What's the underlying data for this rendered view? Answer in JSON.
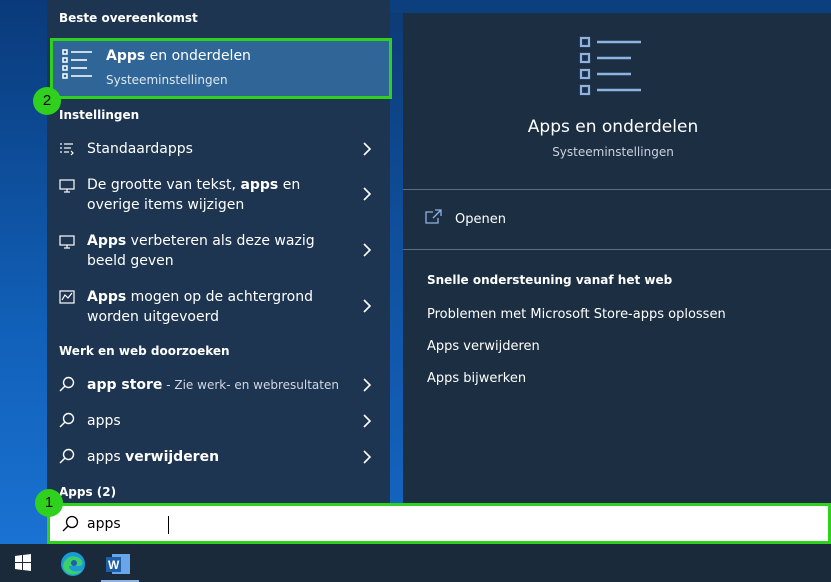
{
  "results": {
    "best_match_header": "Beste overeenkomst",
    "best_match": {
      "title_bold": "Apps",
      "title_rest": " en onderdelen",
      "subtitle": "Systeeminstellingen",
      "icon": "apps-list-icon"
    },
    "settings_header": "Instellingen",
    "settings": [
      {
        "icon": "default-apps-icon",
        "bold": "",
        "text": "Standaardapps",
        "text2": ""
      },
      {
        "icon": "display-icon",
        "pre": "De grootte van tekst, ",
        "bold": "apps",
        "post": " en",
        "line2": "overige items wijzigen"
      },
      {
        "icon": "display-icon",
        "pre": "",
        "bold": "Apps",
        "post": " verbeteren als deze wazig",
        "line2": "beeld geven"
      },
      {
        "icon": "activity-chart-icon",
        "pre": "",
        "bold": "Apps",
        "post": " mogen op de achtergrond",
        "line2": "worden uitgevoerd"
      }
    ],
    "web_header": "Werk en web doorzoeken",
    "web": [
      {
        "icon": "search-icon",
        "pre": "",
        "bold": "app store",
        "hint": " - Zie werk- en webresultaten"
      },
      {
        "icon": "search-icon",
        "pre": "apps",
        "bold": "",
        "hint": ""
      },
      {
        "icon": "search-icon",
        "pre": "apps ",
        "bold": "verwijderen",
        "hint": ""
      }
    ],
    "apps_header": "Apps (2)"
  },
  "preview": {
    "title": "Apps en onderdelen",
    "subtitle": "Systeeminstellingen",
    "open_label": "Openen",
    "web_header": "Snelle ondersteuning vanaf het web",
    "links": [
      "Problemen met Microsoft Store-apps oplossen",
      "Apps verwijderen",
      "Apps bijwerken"
    ]
  },
  "search": {
    "value": "apps",
    "placeholder": ""
  },
  "badges": {
    "one": "1",
    "two": "2"
  },
  "colors": {
    "highlight_green": "#2fd11e",
    "selected_blue": "#2f6597",
    "pane_dark": "#1c2e42",
    "icon_blue": "#8fb3e0"
  }
}
